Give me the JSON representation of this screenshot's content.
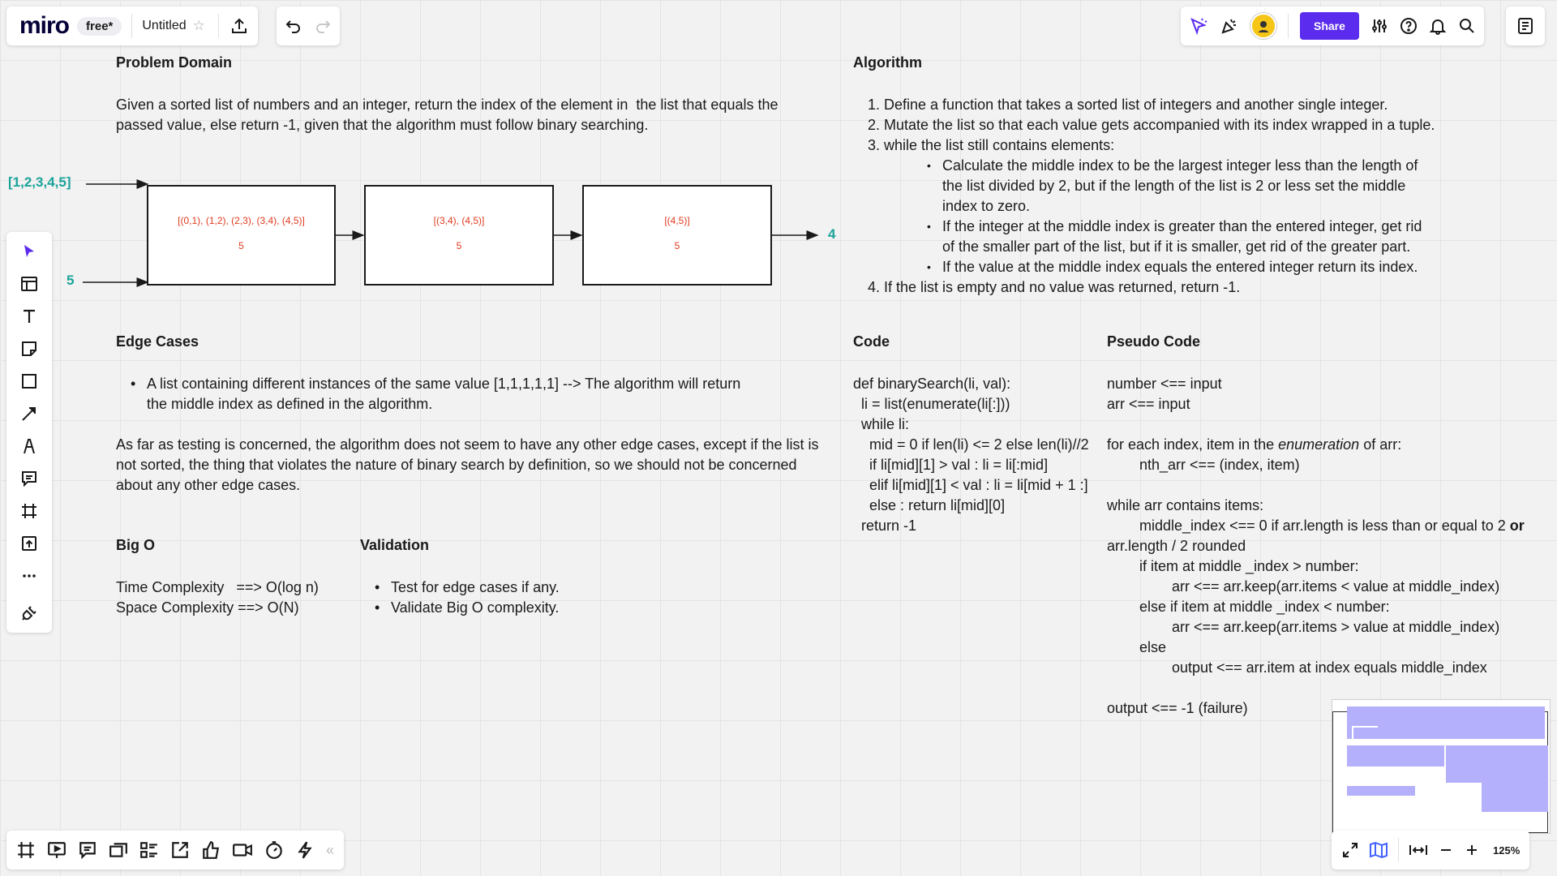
{
  "header": {
    "logo": "miro",
    "plan_badge": "free*",
    "board_title": "Untitled",
    "share_label": "Share",
    "brand_color": "#5b2ced"
  },
  "zoom": "125%",
  "problem_domain": {
    "title": "Problem Domain",
    "text": "Given a sorted list of numbers and an integer, return the index of the element in  the list that equals the\npassed value, else return -1, given that the algorithm must follow binary searching."
  },
  "diagram": {
    "input_list": "[1,2,3,4,5]",
    "input_value": "5",
    "output": "4",
    "boxes": [
      {
        "list": "[(0,1), (1,2), (2,3), (3,4), (4,5)]",
        "value": "5"
      },
      {
        "list": "[(3,4), (4,5)]",
        "value": "5"
      },
      {
        "list": "[(4,5)]",
        "value": "5"
      }
    ]
  },
  "algorithm": {
    "title": "Algorithm",
    "step1": "1. Define a function that takes a sorted list of integers and another single integer.",
    "step2": "2. Mutate the list so that each value gets accompanied with its index wrapped in a tuple.",
    "step3": "3. while the list still contains elements:",
    "sub1": "Calculate the middle index to be the largest integer less than the length of the list divided by 2, but if the length of the list is 2 or less set the middle index to zero.",
    "sub2": "If the integer at the middle index is greater than the entered integer, get rid of the smaller part of the list, but if it is smaller, get rid of the greater part.",
    "sub3": "If the value at the middle index equals the entered integer return its index.",
    "step4": "4. If the list is empty and no value was returned, return -1."
  },
  "edge_cases": {
    "title": "Edge Cases",
    "bullet": "A list containing different instances of the same value [1,1,1,1,1] --> The algorithm will return the middle index as defined in the algorithm.",
    "paragraph": "As far as testing is concerned, the algorithm does not seem to have any other edge cases, except if the list is\nnot sorted, the thing that violates the nature of binary search by definition, so we should not be concerned\nabout any other edge cases."
  },
  "big_o": {
    "title": "Big O",
    "time": "Time Complexity   ==> O(log n)",
    "space": "Space Complexity ==> O(N)"
  },
  "validation": {
    "title": "Validation",
    "item1": "Test for edge cases if any.",
    "item2": "Validate Big O complexity."
  },
  "code": {
    "title": "Code",
    "body": "def binarySearch(li, val):\n  li = list(enumerate(li[:]))\n  while li:\n    mid = 0 if len(li) <= 2 else len(li)//2\n    if li[mid][1] > val : li = li[:mid]\n    elif li[mid][1] < val : li = li[mid + 1 :]\n    else : return li[mid][0]\n  return -1"
  },
  "pseudo_code": {
    "title": "Pseudo Code",
    "l1": "number <== input",
    "l2": "arr <== input",
    "l3a": "for each index, item in the ",
    "l3b": "enumeration",
    "l3c": " of arr:",
    "l4": "        nth_arr <== (index, item)",
    "l5": "while arr contains items:",
    "l6a": "        middle_index <== 0 if arr.length is less than or equal to 2 ",
    "l6b": "or",
    "l7": "arr.length / 2 rounded",
    "l8": "        if item at middle _index > number:",
    "l9": "                arr <== arr.keep(arr.items < value at middle_index)",
    "l10": "        else if item at middle _index < number:",
    "l11": "                arr <== arr.keep(arr.items > value at middle_index)",
    "l12": "        else",
    "l13": "                output <== arr.item at index equals middle_index",
    "l14": "output <== -1 (failure)"
  }
}
